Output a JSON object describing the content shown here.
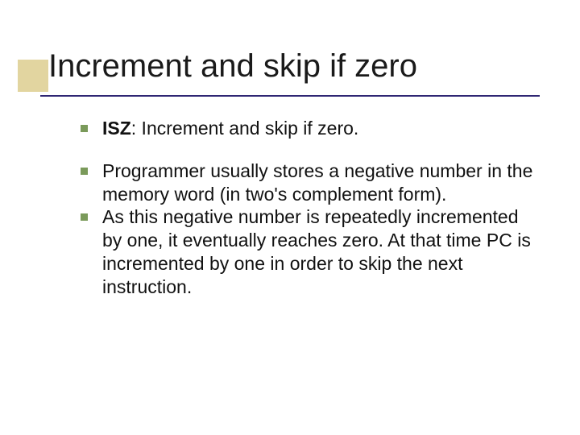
{
  "slide": {
    "title": "Increment and skip if zero",
    "bullets": [
      {
        "prefix": "ISZ",
        "rest": ": Increment and skip if zero."
      },
      {
        "text": "Programmer usually stores a negative number in the memory word (in two's complement form)."
      },
      {
        "text": "As this negative number is repeatedly incremented by one, it eventually reaches zero. At that time PC is incremented by one in order to skip the next instruction."
      }
    ]
  }
}
